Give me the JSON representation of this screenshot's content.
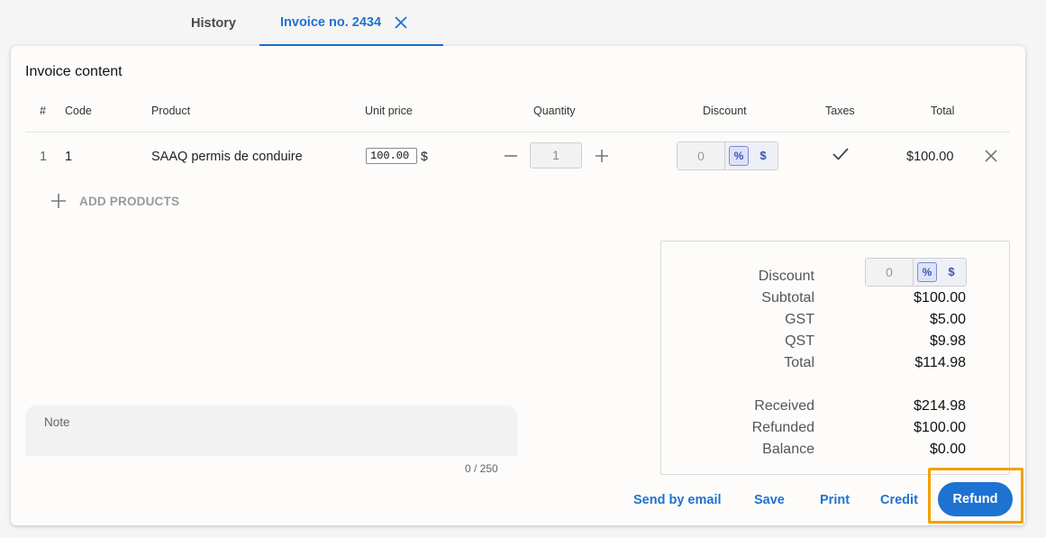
{
  "tabs": {
    "history": "History",
    "invoice": "Invoice no. 2434"
  },
  "invoice": {
    "title": "Invoice content",
    "columns": {
      "num": "#",
      "code": "Code",
      "product": "Product",
      "unit_price": "Unit price",
      "quantity": "Quantity",
      "discount": "Discount",
      "taxes": "Taxes",
      "total": "Total"
    },
    "rows": [
      {
        "num": "1",
        "code": "1",
        "product": "SAAQ permis de conduire",
        "unit_price": "100.00",
        "currency_symbol": "$",
        "quantity": "1",
        "discount": "0",
        "discount_pct_label": "%",
        "discount_usd_label": "$",
        "taxes_icon": "checkmark-icon",
        "total": "$100.00"
      }
    ],
    "add_products": "ADD PRODUCTS"
  },
  "summary": {
    "discount_label": "Discount",
    "discount_value": "0",
    "discount_pct_label": "%",
    "discount_usd_label": "$",
    "subtotal_label": "Subtotal",
    "subtotal": "$100.00",
    "gst_label": "GST",
    "gst": "$5.00",
    "qst_label": "QST",
    "qst": "$9.98",
    "total_label": "Total",
    "total": "$114.98",
    "received_label": "Received",
    "received": "$214.98",
    "refunded_label": "Refunded",
    "refunded": "$100.00",
    "balance_label": "Balance",
    "balance": "$0.00"
  },
  "note": {
    "label": "Note",
    "counter": "0 / 250"
  },
  "actions": {
    "send_email": "Send by email",
    "save": "Save",
    "print": "Print",
    "credit": "Credit",
    "refund": "Refund"
  },
  "colors": {
    "accent": "#1e72d2",
    "highlight": "#f4a000",
    "discount_toggle": "#3f51b5"
  }
}
